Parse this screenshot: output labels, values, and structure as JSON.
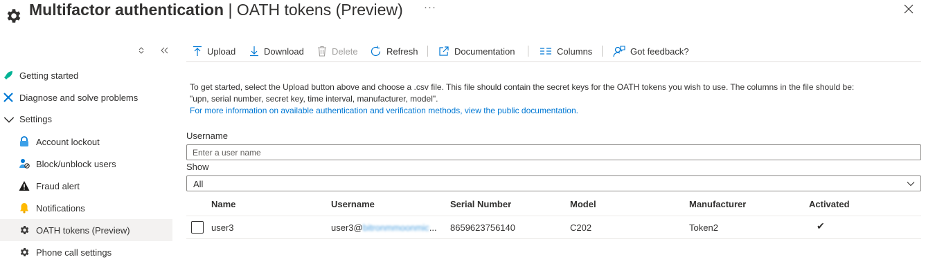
{
  "header": {
    "title_strong": "Multifactor authentication",
    "title_rest": " | OATH tokens (Preview)",
    "more": "···"
  },
  "sidebar": {
    "items": [
      {
        "label": "Getting started",
        "icon": "rocket-icon"
      },
      {
        "label": "Diagnose and solve problems",
        "icon": "wrench-icon"
      },
      {
        "label": "Settings",
        "icon": "chevron-down-icon"
      },
      {
        "label": "Account lockout",
        "icon": "lock-icon"
      },
      {
        "label": "Block/unblock users",
        "icon": "user-block-icon"
      },
      {
        "label": "Fraud alert",
        "icon": "warning-icon"
      },
      {
        "label": "Notifications",
        "icon": "bell-icon"
      },
      {
        "label": "OATH tokens (Preview)",
        "icon": "gear-icon"
      },
      {
        "label": "Phone call settings",
        "icon": "gear-icon"
      }
    ]
  },
  "toolbar": {
    "upload": "Upload",
    "download": "Download",
    "delete": "Delete",
    "refresh": "Refresh",
    "documentation": "Documentation",
    "columns": "Columns",
    "feedback": "Got feedback?"
  },
  "info": {
    "line1": "To get started, select the Upload button above and choose a .csv file. This file should contain the secret keys for the OATH tokens you wish to use. The columns in the file should be:",
    "line2": "\"upn, serial number, secret key, time interval, manufacturer, model\".",
    "link": "For more information on available authentication and verification methods, view the public documentation."
  },
  "form": {
    "username_label": "Username",
    "username_placeholder": "Enter a user name",
    "show_label": "Show",
    "show_value": "All"
  },
  "table": {
    "headers": {
      "name": "Name",
      "username": "Username",
      "serial": "Serial Number",
      "model": "Model",
      "manufacturer": "Manufacturer",
      "activated": "Activated"
    },
    "rows": [
      {
        "name": "user3",
        "username_visible": "user3@",
        "username_redacted": "bitronmmoonmic",
        "username_ellipsis": "...",
        "serial": "8659623756140",
        "model": "C202",
        "manufacturer": "Token2",
        "activated": "✔"
      }
    ]
  },
  "colors": {
    "accent": "#0078d4",
    "selected_nav": "#f3f2f1"
  }
}
